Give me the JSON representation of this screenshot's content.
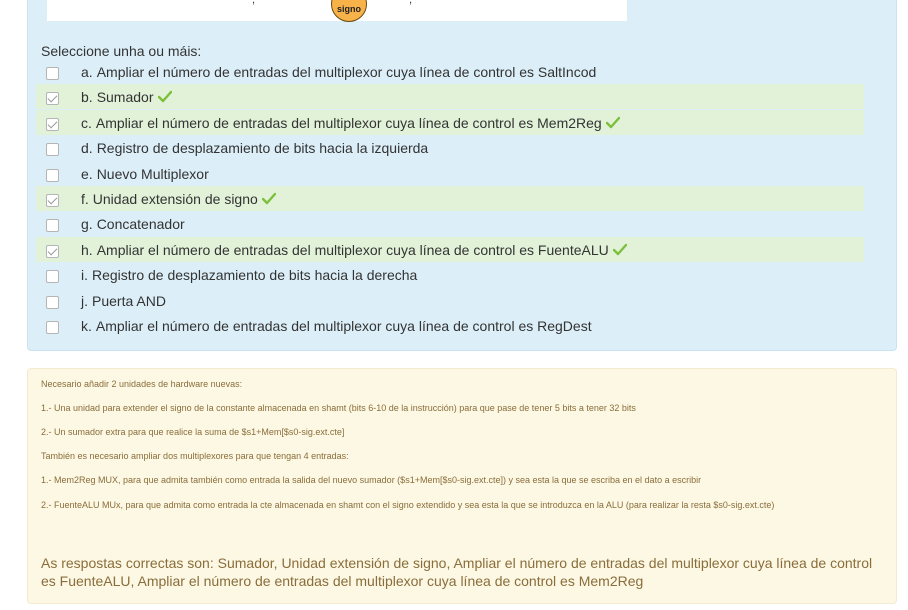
{
  "figure": {
    "circle_label": "signo",
    "marks": [
      ",",
      ","
    ]
  },
  "question": {
    "prompt": "Seleccione unha ou máis:",
    "options": [
      {
        "letter": "a.",
        "text": "Ampliar el número de entradas del multiplexor cuya línea de control es SaltIncod",
        "checked": false,
        "correct": false
      },
      {
        "letter": "b.",
        "text": "Sumador",
        "checked": true,
        "correct": true
      },
      {
        "letter": "c.",
        "text": "Ampliar el número de entradas del multiplexor cuya línea de control es Mem2Reg",
        "checked": true,
        "correct": true
      },
      {
        "letter": "d.",
        "text": "Registro de desplazamiento de bits hacia la izquierda",
        "checked": false,
        "correct": false
      },
      {
        "letter": "e.",
        "text": "Nuevo Multiplexor",
        "checked": false,
        "correct": false
      },
      {
        "letter": "f.",
        "text": "Unidad extensión de signo",
        "checked": true,
        "correct": true
      },
      {
        "letter": "g.",
        "text": "Concatenador",
        "checked": false,
        "correct": false
      },
      {
        "letter": "h.",
        "text": "Ampliar el número de entradas del multiplexor cuya línea de control es FuenteALU",
        "checked": true,
        "correct": true
      },
      {
        "letter": "i.",
        "text": "Registro de desplazamiento de bits hacia la derecha",
        "checked": false,
        "correct": false
      },
      {
        "letter": "j.",
        "text": "Puerta AND",
        "checked": false,
        "correct": false
      },
      {
        "letter": "k.",
        "text": "Ampliar el número de entradas del multiplexor cuya línea de control es RegDest",
        "checked": false,
        "correct": false
      }
    ]
  },
  "feedback": {
    "lines": [
      "Necesario añadir 2 unidades de hardware nuevas:",
      "1.- Una unidad para extender el signo de la constante almacenada en shamt (bits 6-10 de la instrucción) para que pase de tener 5 bits a tener 32 bits",
      "2.- Un sumador extra para que realice la suma de $s1+Mem[$s0-sig.ext.cte]",
      "También es necesario ampliar dos multiplexores para que tengan 4 entradas:",
      "1.- Mem2Reg MUX, para que admita también como entrada la salida del nuevo sumador ($s1+Mem[$s0-sig.ext.cte]) y sea esta la que se escriba en el dato a escribir",
      "2.- FuenteALU MUx, para que admita como entrada la cte almacenada en shamt con el signo extendido y sea esta la que se introduzca en la ALU (para realizar la resta $s0-sig.ext.cte)"
    ],
    "answer": "As respostas correctas son: Sumador, Unidad extensión de signo, Ampliar el número de entradas del multiplexor cuya línea de control es FuenteALU, Ampliar el número de entradas del multiplexor cuya línea de control es Mem2Reg"
  },
  "colors": {
    "question_bg": "#dceff8",
    "correct_bg": "#e2f2d9",
    "feedback_bg": "#fcf8e3",
    "feedback_text": "#8a6d3b",
    "tick": "#7cbf3a"
  }
}
